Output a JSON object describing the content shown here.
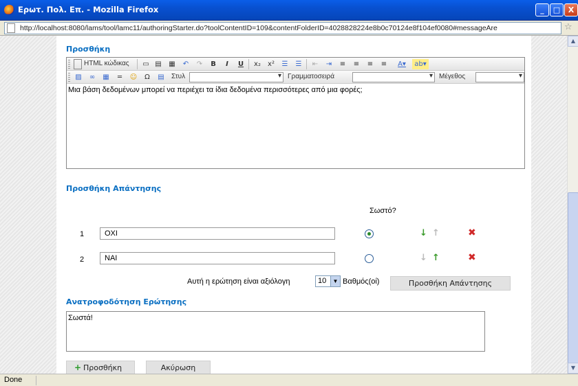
{
  "window": {
    "title": "Ερωτ. Πολ. Επ. - Mozilla Firefox",
    "controls": {
      "minimize": "_",
      "maximize": "□",
      "close": "X"
    }
  },
  "browser": {
    "url": "http://localhost:8080/lams/tool/lamc11/authoringStarter.do?toolContentID=109&contentFolderID=4028828224e8b0c70124e8f104ef0080#messageAre",
    "status": "Done"
  },
  "question_section": {
    "title": "Προσθήκη",
    "toolbar": {
      "html_label": "HTML κώδικας",
      "style_label": "Στυλ",
      "font_label": "Γραμματοσειρά",
      "size_label": "Μέγεθος"
    },
    "question_text": "Μια βάση δεδομένων μπορεί να περιέχει τα ίδια δεδομένα περισσότερες από μια φορές;"
  },
  "answers_section": {
    "title": "Προσθήκη Απάντησης",
    "correct_header": "Σωστό?",
    "answers": [
      {
        "number": "1",
        "text": "ΟΧΙ",
        "correct": true
      },
      {
        "number": "2",
        "text": "ΝΑΙ",
        "correct": false
      }
    ],
    "mark_label": "Αυτή η ερώτηση είναι αξιόλογη",
    "mark_value": "10",
    "mark_unit": "Βαθμός(οί)",
    "add_answer_button": "Προσθήκη Απάντησης"
  },
  "feedback_section": {
    "title": "Ανατροφοδότηση Ερώτησης",
    "text": "Σωστά!"
  },
  "actions": {
    "add_button": "Προσθήκη",
    "cancel_button": "Ακύρωση"
  },
  "colors": {
    "section_title": "#0a6fc2",
    "titlebar": "#0850d0",
    "arrow_active": "#3a9a2a",
    "delete": "#d02828"
  }
}
